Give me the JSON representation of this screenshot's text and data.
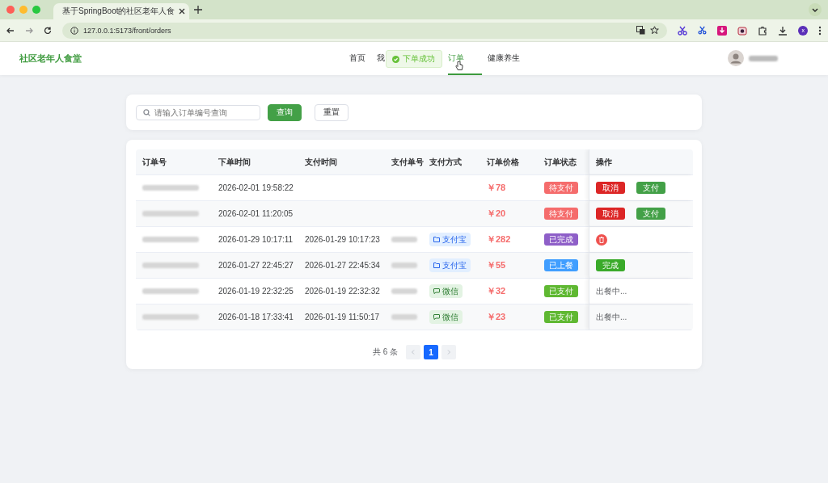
{
  "browser": {
    "tab_title": "基于SpringBoot的社区老年人食",
    "url": "127.0.0.1:5173/front/orders",
    "profile_initial": "x"
  },
  "header": {
    "brand": "社区老年人食堂",
    "nav": [
      {
        "label": "首页",
        "selected": false
      },
      {
        "label": "我",
        "selected": false
      },
      {
        "label": "订单",
        "selected": true
      },
      {
        "label": "健康养生",
        "selected": false
      }
    ],
    "toast": "下单成功"
  },
  "search": {
    "placeholder": "请输入订单编号查询",
    "buttons": [
      {
        "label": "查询",
        "kind": "primary"
      },
      {
        "label": "重置",
        "kind": "plain"
      }
    ]
  },
  "table": {
    "columns": [
      "订单号",
      "下单时间",
      "支付时间",
      "支付单号",
      "支付方式",
      "订单价格",
      "订单状态",
      "操作"
    ],
    "rows": [
      {
        "order_time": "2026-02-01 19:58:22",
        "price": "￥78",
        "status": {
          "label": "待支付",
          "color": "#f56c6c"
        },
        "actions": [
          {
            "kind": "button",
            "label": "取消",
            "color": "#dc2626"
          },
          {
            "kind": "button",
            "label": "支付",
            "color": "#43a047"
          }
        ]
      },
      {
        "order_time": "2026-02-01 11:20:05",
        "price": "￥20",
        "status": {
          "label": "待支付",
          "color": "#f56c6c"
        },
        "actions": [
          {
            "kind": "button",
            "label": "取消",
            "color": "#dc2626"
          },
          {
            "kind": "button",
            "label": "支付",
            "color": "#43a047"
          }
        ]
      },
      {
        "order_time": "2026-01-29 10:17:11",
        "pay_time": "2026-01-29 10:17:23",
        "pay_method": {
          "kind": "alipay",
          "label": "支付宝"
        },
        "price": "￥282",
        "status": {
          "label": "已完成",
          "color": "#8e5fc8"
        },
        "actions": [
          {
            "kind": "delete"
          }
        ]
      },
      {
        "order_time": "2026-01-27 22:45:27",
        "pay_time": "2026-01-27 22:45:34",
        "pay_method": {
          "kind": "alipay",
          "label": "支付宝"
        },
        "price": "￥55",
        "status": {
          "label": "已上餐",
          "color": "#409eff"
        },
        "actions": [
          {
            "kind": "button",
            "label": "完成",
            "color": "#3aaa2a"
          }
        ]
      },
      {
        "order_time": "2026-01-19 22:32:25",
        "pay_time": "2026-01-19 22:32:32",
        "pay_method": {
          "kind": "wechat",
          "label": "微信"
        },
        "price": "￥32",
        "status": {
          "label": "已支付",
          "color": "#5fb832"
        },
        "actions": [
          {
            "kind": "text",
            "label": "出餐中..."
          }
        ]
      },
      {
        "order_time": "2026-01-18 17:33:41",
        "pay_time": "2026-01-19 11:50:17",
        "pay_method": {
          "kind": "wechat",
          "label": "微信"
        },
        "price": "￥23",
        "status": {
          "label": "已支付",
          "color": "#5fb832"
        },
        "actions": [
          {
            "kind": "text",
            "label": "出餐中..."
          }
        ]
      }
    ]
  },
  "pagination": {
    "total": "共 6 条",
    "pages": [
      {
        "label": "1",
        "selected": true
      }
    ]
  }
}
